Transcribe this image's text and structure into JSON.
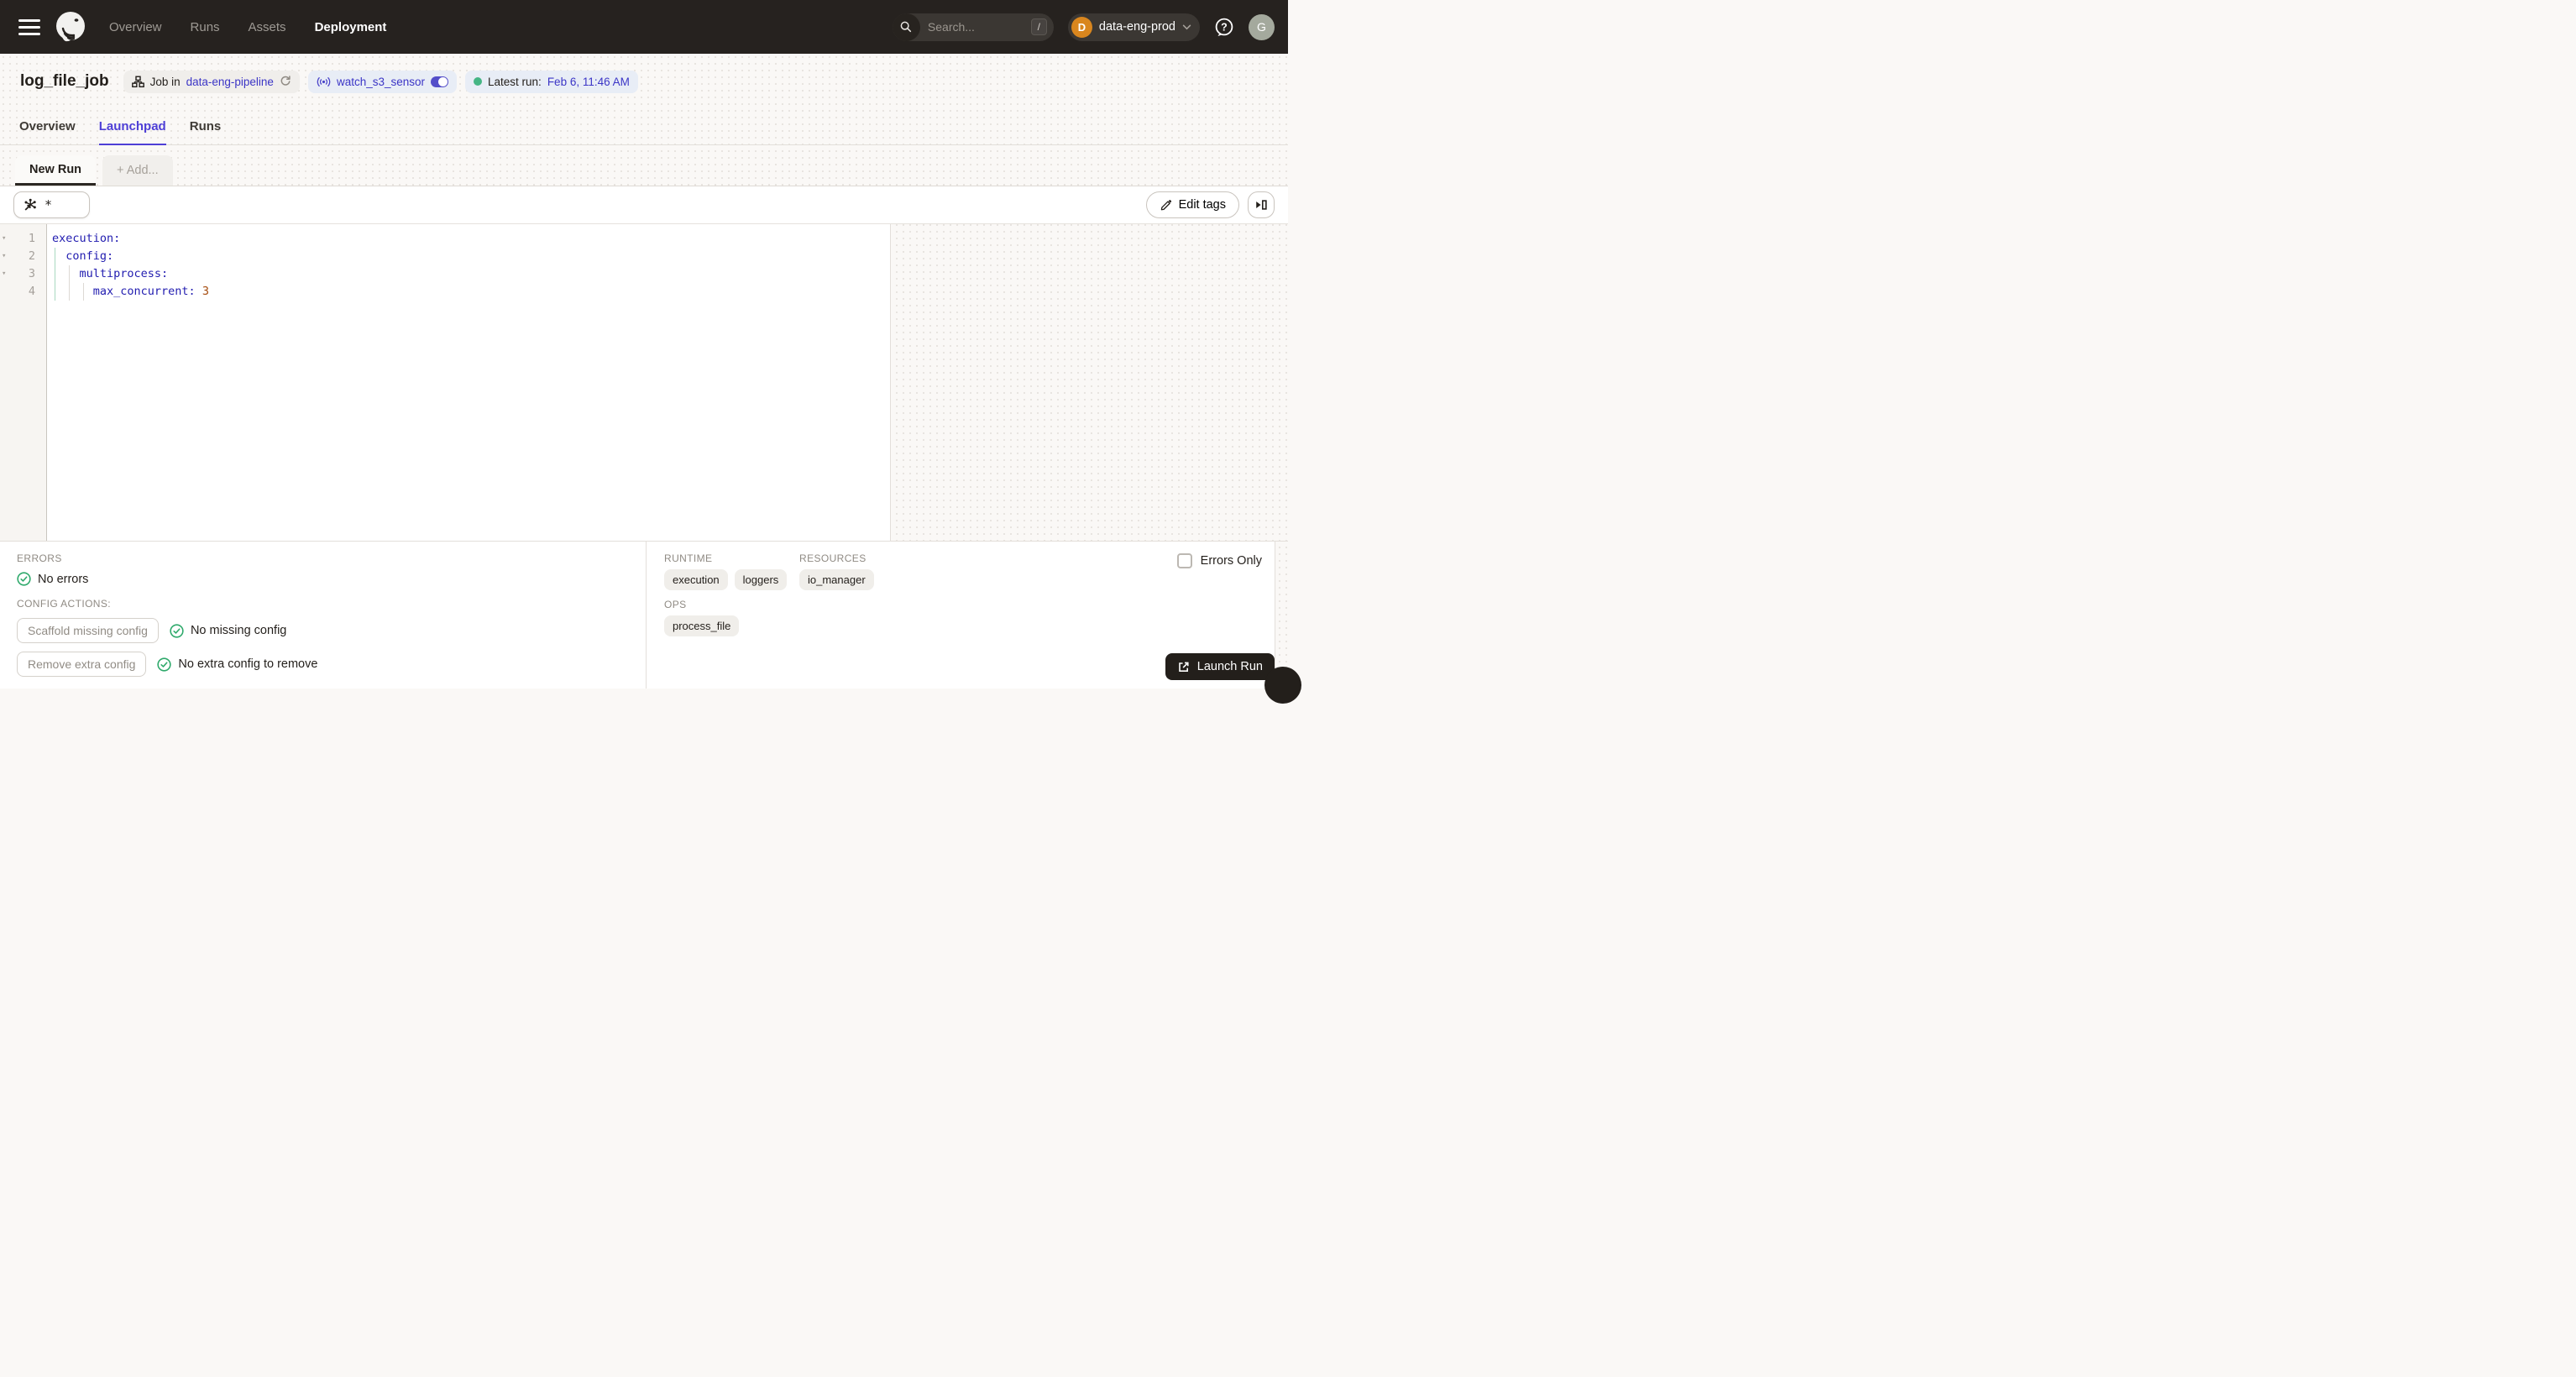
{
  "topnav": {
    "nav_items": [
      {
        "label": "Overview",
        "active": false
      },
      {
        "label": "Runs",
        "active": false
      },
      {
        "label": "Assets",
        "active": false
      },
      {
        "label": "Deployment",
        "active": true
      }
    ],
    "search": {
      "placeholder": "Search...",
      "shortcut": "/"
    },
    "deployment_switcher": {
      "initial": "D",
      "name": "data-eng-prod"
    },
    "user_initial": "G"
  },
  "header": {
    "title": "log_file_job",
    "job_badge": {
      "prefix": "Job in",
      "link": "data-eng-pipeline"
    },
    "sensor_badge": {
      "name": "watch_s3_sensor",
      "enabled": true
    },
    "latest_run_badge": {
      "label": "Latest run:",
      "value": "Feb 6, 11:46 AM"
    }
  },
  "tabs": [
    {
      "label": "Overview",
      "active": false
    },
    {
      "label": "Launchpad",
      "active": true
    },
    {
      "label": "Runs",
      "active": false
    }
  ],
  "launchpad": {
    "config_tabs": [
      {
        "label": "New Run",
        "active": true
      },
      {
        "label": "+ Add...",
        "active": false
      }
    ],
    "op_selector_value": "*",
    "edit_tags_label": "Edit tags",
    "editor": {
      "lines": [
        {
          "num": "1",
          "key": "execution:",
          "value": ""
        },
        {
          "num": "2",
          "key": "  config:",
          "value": ""
        },
        {
          "num": "3",
          "key": "    multiprocess:",
          "value": ""
        },
        {
          "num": "4",
          "key": "      max_concurrent:",
          "value": " 3"
        }
      ]
    }
  },
  "bottom": {
    "errors_label": "ERRORS",
    "no_errors": "No errors",
    "config_actions_label": "CONFIG ACTIONS:",
    "scaffold_button": "Scaffold missing config",
    "scaffold_status": "No missing config",
    "remove_button": "Remove extra config",
    "remove_status": "No extra config to remove",
    "runtime_label": "RUNTIME",
    "resources_label": "RESOURCES",
    "ops_label": "OPS",
    "runtime_chips": [
      "execution",
      "loggers"
    ],
    "resources_chips": [
      "io_manager"
    ],
    "ops_chips": [
      "process_file"
    ],
    "errors_only_label": "Errors Only",
    "launch_button": "Launch Run"
  },
  "colors": {
    "topnav_bg": "#26221F",
    "accent_indigo": "#4E3FD6",
    "link_blue": "#3B35C6",
    "toggle_on": "#544EC9",
    "status_green": "#45B584",
    "check_green": "#2EA96B",
    "deploy_avatar_orange": "#D9861E",
    "user_avatar_sage": "#A4A99D",
    "yaml_key": "#211CB0",
    "yaml_value": "#A44A0C",
    "dark_button": "#231F1B"
  }
}
